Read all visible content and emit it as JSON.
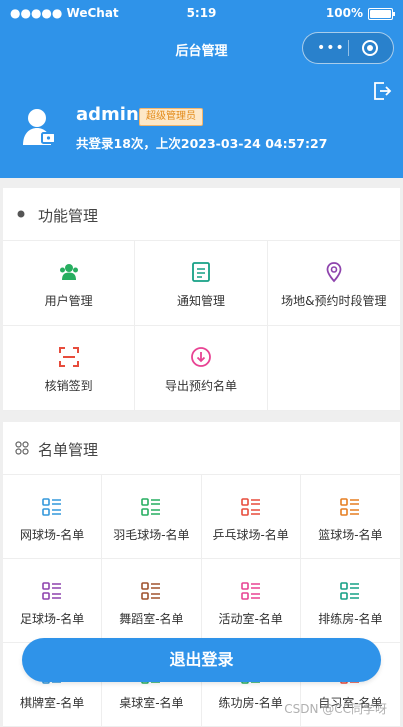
{
  "status_bar": {
    "carrier": "●●●●● WeChat",
    "time": "5:19",
    "battery": "100%"
  },
  "navbar": {
    "title": "后台管理"
  },
  "profile": {
    "username": "admin",
    "role_badge": "超级管理员",
    "login_info": "共登录18次，上次2023-03-24 04:57:27"
  },
  "func_section": {
    "title": "功能管理",
    "items": [
      {
        "label": "用户管理",
        "icon": "users-icon",
        "color": "#27ae60"
      },
      {
        "label": "通知管理",
        "icon": "notice-icon",
        "color": "#16a085"
      },
      {
        "label": "场地&预约时段管理",
        "icon": "location-pin-icon",
        "color": "#8e44ad"
      },
      {
        "label": "核销签到",
        "icon": "scan-icon",
        "color": "#e74c3c"
      },
      {
        "label": "导出预约名单",
        "icon": "download-circle-icon",
        "color": "#e84393"
      }
    ]
  },
  "list_section": {
    "title": "名单管理",
    "items": [
      {
        "label": "网球场-名单",
        "color": "#3498db"
      },
      {
        "label": "羽毛球场-名单",
        "color": "#27ae60"
      },
      {
        "label": "乒乓球场-名单",
        "color": "#e74c3c"
      },
      {
        "label": "篮球场-名单",
        "color": "#e67e22"
      },
      {
        "label": "足球场-名单",
        "color": "#8e44ad"
      },
      {
        "label": "舞蹈室-名单",
        "color": "#a0522d"
      },
      {
        "label": "活动室-名单",
        "color": "#e84393"
      },
      {
        "label": "排练房-名单",
        "color": "#16a085"
      },
      {
        "label": "棋牌室-名单",
        "color": "#3498db"
      },
      {
        "label": "桌球室-名单",
        "color": "#27ae60"
      },
      {
        "label": "练功房-名单",
        "color": "#27ae60"
      },
      {
        "label": "自习室-名单",
        "color": "#e74c3c"
      }
    ]
  },
  "logout_button": "退出登录",
  "watermark": "CSDN @CC同学呀"
}
